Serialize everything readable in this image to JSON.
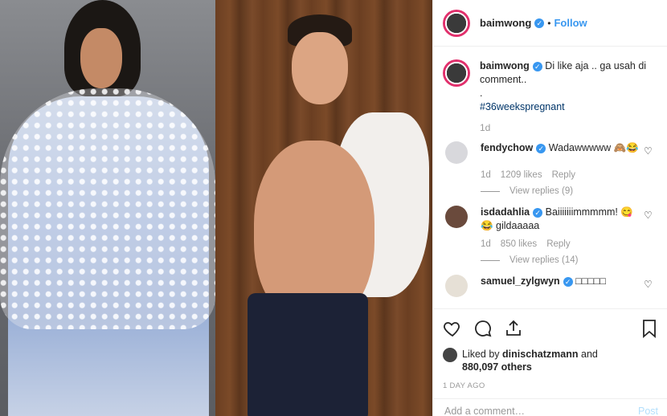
{
  "post": {
    "username": "baimwong",
    "follow_label": "Follow",
    "dot": "•"
  },
  "caption": {
    "username": "baimwong",
    "text": "Di like aja .. ga usah di comment..",
    "dot": ".",
    "hashtag": "#36weekspregnant",
    "time": "1d"
  },
  "comments": [
    {
      "username": "fendychow",
      "text": "Wadawwwww 🙈😂",
      "time": "1d",
      "likes": "1209 likes",
      "reply_label": "Reply",
      "view_replies": "View replies (9)"
    },
    {
      "username": "isdadahlia",
      "text": "Baiiiiiiimmmmm! 😋",
      "text2": "😂 gildaaaaa",
      "time": "1d",
      "likes": "850 likes",
      "reply_label": "Reply",
      "view_replies": "View replies (14)"
    },
    {
      "username": "samuel_zylgwyn",
      "text": "□□□□□"
    }
  ],
  "actions": {
    "liked_by_prefix": "Liked by",
    "liked_by_user": "dinischatzmann",
    "and": "and",
    "others": "880,097 others",
    "ago": "1 DAY AGO"
  },
  "add_comment": {
    "placeholder": "Add a comment…",
    "post_label": "Post"
  },
  "colors": {
    "link_blue": "#3897f0",
    "hashtag": "#003569",
    "muted": "#999999"
  }
}
